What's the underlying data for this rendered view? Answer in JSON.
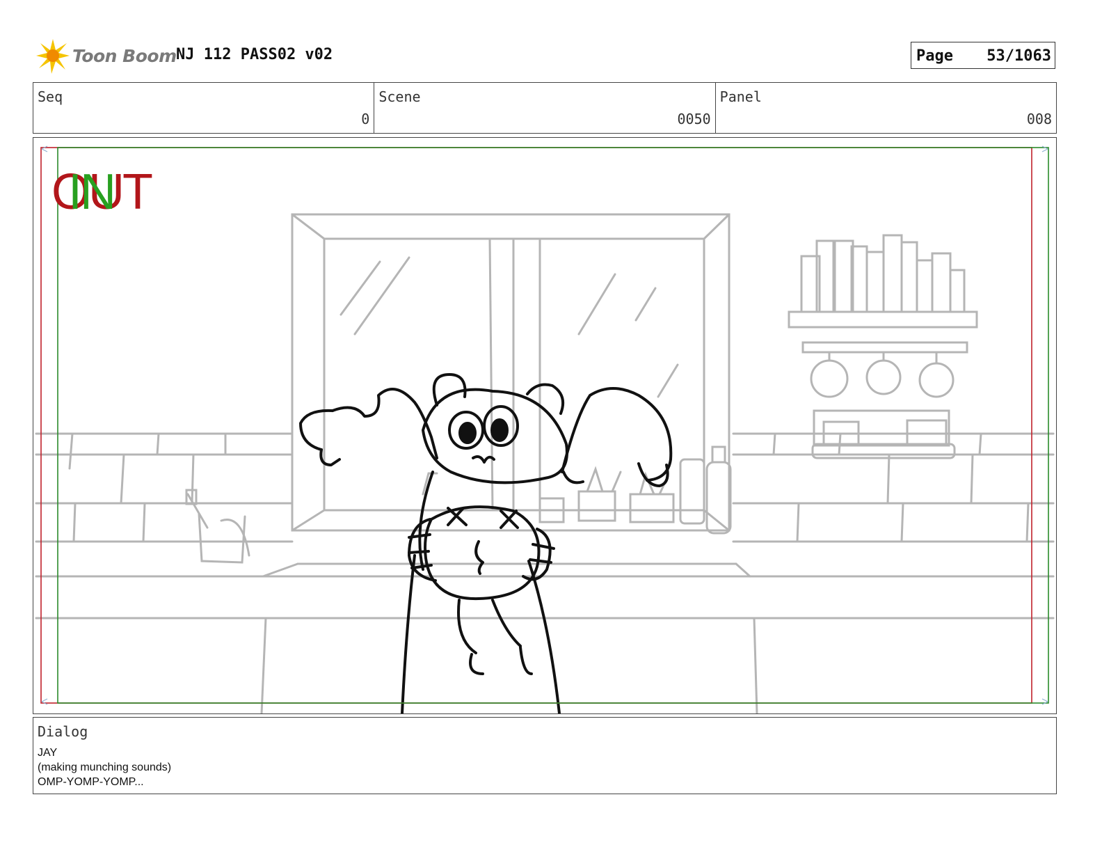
{
  "header": {
    "logo_text": "Toon Boom",
    "document_title": "NJ 112 PASS02 v02",
    "page_label": "Page",
    "page_value": "53/1063"
  },
  "info": {
    "seq_label": "Seq",
    "seq_value": "0",
    "scene_label": "Scene",
    "scene_value": "0050",
    "panel_label": "Panel",
    "panel_value": "008"
  },
  "panel": {
    "in_marker": "IN",
    "out_marker": "OUT",
    "in_color": "#28a020",
    "out_color": "#b2161a"
  },
  "dialog": {
    "label": "Dialog",
    "lines": [
      "JAY",
      "(making munching sounds)",
      "OMP-YOMP-YOMP..."
    ]
  }
}
